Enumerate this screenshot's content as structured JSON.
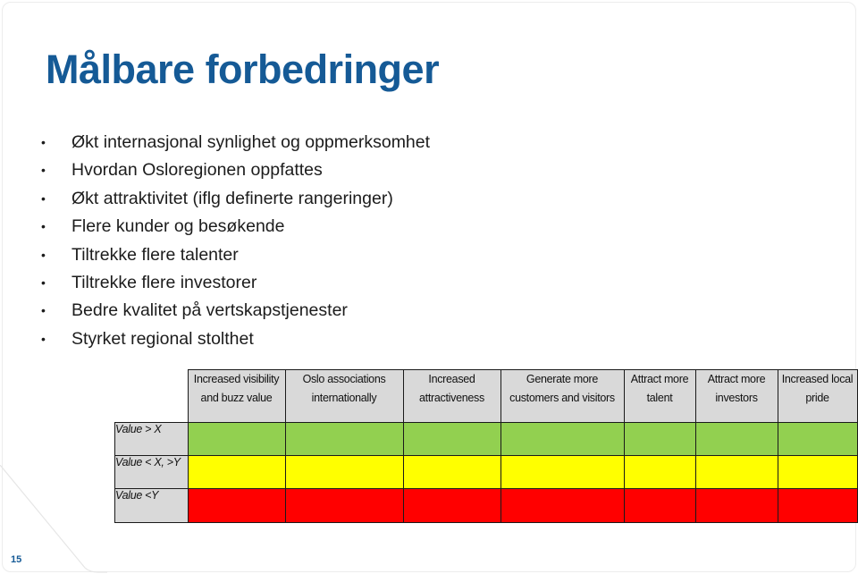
{
  "slide": {
    "title": "Målbare forbedringer",
    "bullets": [
      "Økt internasjonal synlighet og oppmerksomhet",
      "Hvordan Osloregionen oppfattes",
      "Økt attraktivitet (iflg definerte rangeringer)",
      "Flere kunder og besøkende",
      "Tiltrekke flere talenter",
      "Tiltrekke flere investorer",
      "Bedre kvalitet på vertskapstjenester",
      "Styrket regional stolthet"
    ],
    "bullet_glyph": "•",
    "page_number": "15"
  },
  "matrix": {
    "columns": [
      {
        "line1": "Increased visibility",
        "line2": "and buzz value"
      },
      {
        "line1": "Oslo associations",
        "line2": "internationally"
      },
      {
        "line1": "Increased",
        "line2": "attractiveness"
      },
      {
        "line1": "Generate more",
        "line2": "customers and visitors"
      },
      {
        "line1": "Attract more",
        "line2": "talent"
      },
      {
        "line1": "Attract more",
        "line2": "investors"
      },
      {
        "line1": "Increased local",
        "line2": "pride"
      }
    ],
    "rows": [
      {
        "label": "Value > X",
        "status": "green",
        "color": "#92d050"
      },
      {
        "label": "Value < X, >Y",
        "status": "yellow",
        "color": "#ffff00"
      },
      {
        "label": "Value <Y",
        "status": "red",
        "color": "#ff0000"
      }
    ]
  },
  "colors": {
    "title": "#155a96",
    "header_fill": "#d9d9d9"
  }
}
